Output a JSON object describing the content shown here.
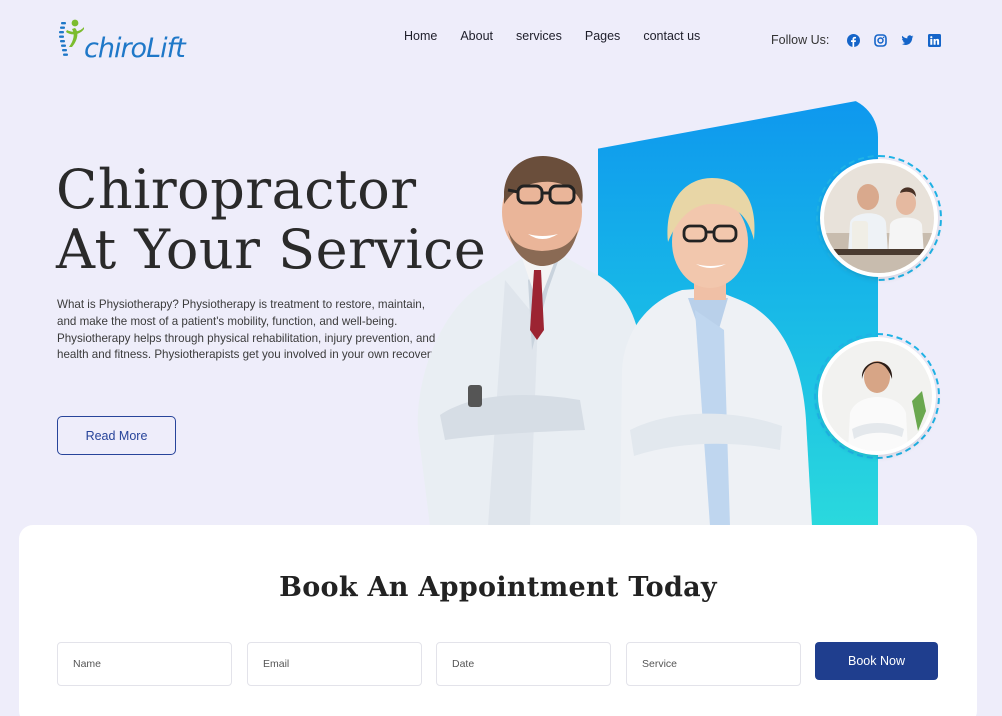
{
  "brand": {
    "name": "chiroLift",
    "logo_icon": "spine-figure-icon"
  },
  "nav": {
    "items": [
      "Home",
      "About",
      "services",
      "Pages",
      "contact us"
    ]
  },
  "follow": {
    "label": "Follow Us:",
    "icons": [
      "facebook-icon",
      "instagram-icon",
      "twitter-icon",
      "linkedin-icon"
    ]
  },
  "hero": {
    "title_line1": "Chiropractor",
    "title_line2": "At Your Service",
    "description": "What is Physiotherapy? Physiotherapy is treatment to restore, maintain, and make the most of a patient's mobility, function, and well-being. Physiotherapy helps through physical rehabilitation, injury prevention, and health and fitness. Physiotherapists get you involved in your own recovery.",
    "cta": "Read More"
  },
  "appointment": {
    "title": "Book An Appointment Today",
    "fields": {
      "name": "Name",
      "email": "Email",
      "date": "Date",
      "service": "Service"
    },
    "submit": "Book Now"
  },
  "colors": {
    "accent": "#1f3e8e",
    "brand_blue": "#1f78c8",
    "brand_green": "#7cbc2e",
    "gradient_top": "#0e97ee",
    "gradient_bottom": "#2ad9dd",
    "page_bg": "#eeedfa"
  }
}
